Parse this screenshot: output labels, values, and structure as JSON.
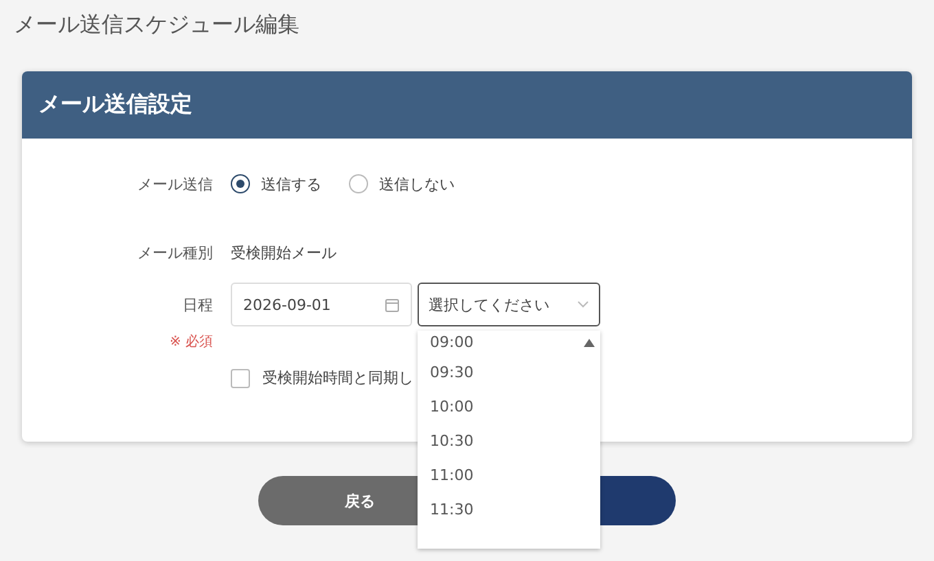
{
  "page_title": "メール送信スケジュール編集",
  "card": {
    "title": "メール送信設定"
  },
  "send_field": {
    "label": "メール送信",
    "options": [
      {
        "label": "送信する",
        "selected": true
      },
      {
        "label": "送信しない",
        "selected": false
      }
    ]
  },
  "type_field": {
    "label": "メール種別",
    "value": "受検開始メール"
  },
  "schedule_field": {
    "label": "日程",
    "required": "※ 必須",
    "date": "2026-09-01",
    "time_select": {
      "placeholder": "選択してください",
      "expanded": true,
      "options": [
        "09:00",
        "09:30",
        "10:00",
        "10:30",
        "11:00",
        "11:30"
      ]
    },
    "sync_checkbox": {
      "label": "受検開始時間と同期し",
      "checked": false
    }
  },
  "buttons": [
    {
      "label": "戻る",
      "kind": "secondary"
    },
    {
      "kind": "primary"
    }
  ]
}
